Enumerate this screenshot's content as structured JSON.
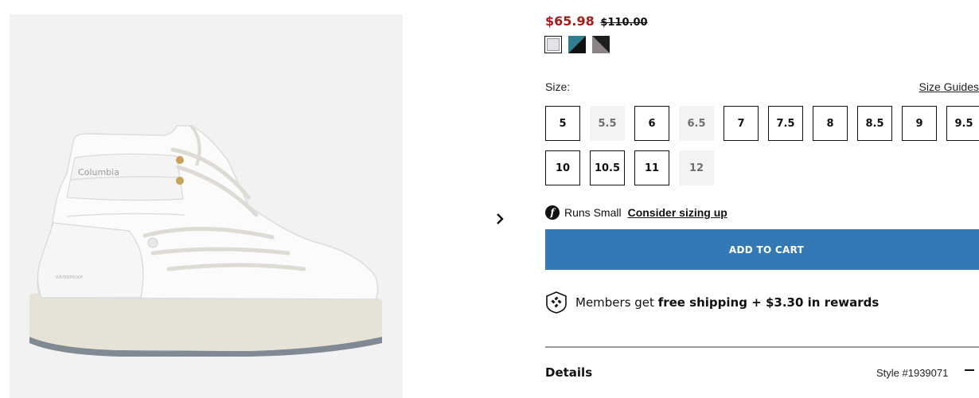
{
  "product": {
    "image_alt": "white winter boot",
    "brand_mark": "Columbia",
    "waterproof_mark": "WATERPROOF"
  },
  "gallery": {
    "next_icon": "chevron-right-icon"
  },
  "price": {
    "sale": "$65.98",
    "original": "$110.00",
    "sale_color": "#a51c1c"
  },
  "swatches": [
    {
      "name": "light-grey",
      "colors": [
        "#e4e3ea",
        "#e4e3ea"
      ],
      "selected": true
    },
    {
      "name": "teal-black",
      "colors": [
        "#2f7d8e",
        "#111111"
      ],
      "selected": false
    },
    {
      "name": "grey-black",
      "colors": [
        "#8a8583",
        "#1e1e1e"
      ],
      "selected": false
    }
  ],
  "size": {
    "label": "Size:",
    "guides_link": "Size Guides",
    "options": [
      {
        "label": "5",
        "available": true
      },
      {
        "label": "5.5",
        "available": false
      },
      {
        "label": "6",
        "available": true
      },
      {
        "label": "6.5",
        "available": false
      },
      {
        "label": "7",
        "available": true
      },
      {
        "label": "7.5",
        "available": true
      },
      {
        "label": "8",
        "available": true
      },
      {
        "label": "8.5",
        "available": true
      },
      {
        "label": "9",
        "available": true
      },
      {
        "label": "9.5",
        "available": true
      },
      {
        "label": "10",
        "available": true
      },
      {
        "label": "10.5",
        "available": true
      },
      {
        "label": "11",
        "available": true
      },
      {
        "label": "12",
        "available": false
      }
    ]
  },
  "fit": {
    "icon": "fit-predictor-icon",
    "text": "Runs Small",
    "link": "Consider sizing up"
  },
  "cart": {
    "button_label": "ADD TO CART",
    "button_color": "#3279b5"
  },
  "members": {
    "icon": "columbia-rewards-icon",
    "prefix": "Members get ",
    "bold": "free shipping + $3.30 in rewards"
  },
  "details": {
    "title": "Details",
    "style": "Style #1939071",
    "toggle_icon": "minus-icon"
  }
}
